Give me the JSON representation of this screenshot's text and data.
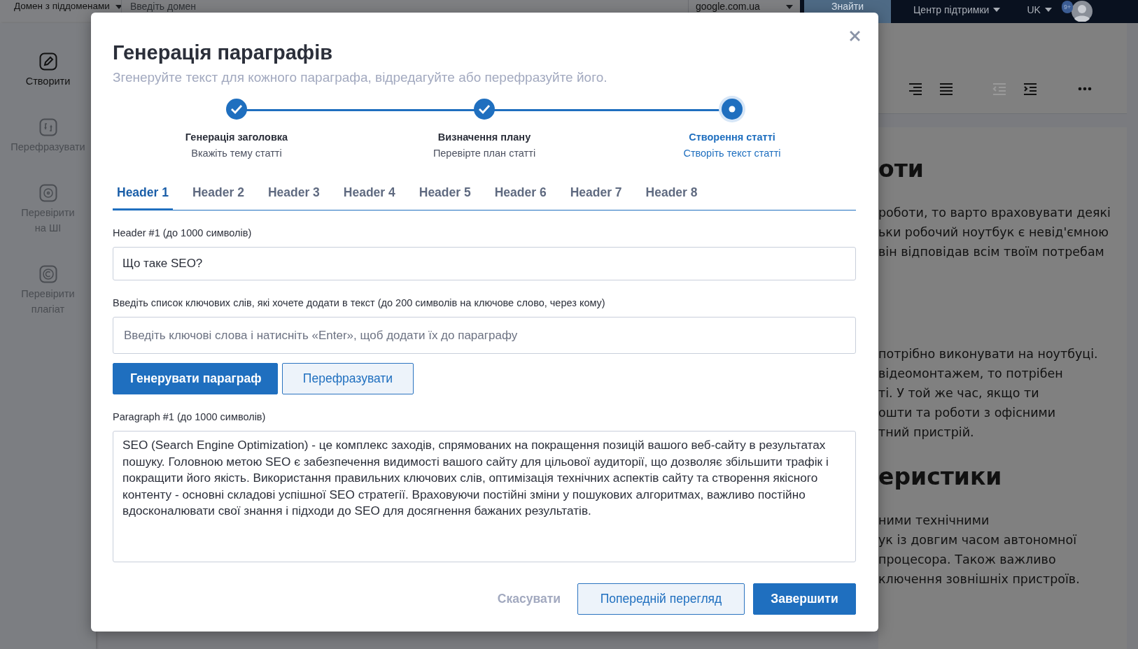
{
  "top_bar": {
    "domain_mode": "Домен з піддоменами",
    "domain_input": {
      "placeholder": "Введіть домен"
    },
    "search_engine": "google.com.ua",
    "search_button": "Знайти",
    "support": "Центр підтримки",
    "language": "UK",
    "notifications_badge": "9+"
  },
  "sidebar": {
    "items": [
      {
        "label": "Створити",
        "kind": "pen",
        "selected": true
      },
      {
        "label": "Перефразувати",
        "kind": "refresh",
        "selected": false
      },
      {
        "label": "Перевірити на ШІ",
        "kind": "target",
        "selected": false
      },
      {
        "label": "Перевірити плагіат",
        "kind": "copyright",
        "selected": false
      }
    ]
  },
  "editor": {
    "toolbar": [
      {
        "kind": "align-right",
        "disabled": false
      },
      {
        "kind": "justify",
        "disabled": false
      },
      {
        "kind": "outdent",
        "disabled": true
      },
      {
        "kind": "indent",
        "disabled": false
      },
      {
        "kind": "more",
        "disabled": false
      }
    ],
    "document": [
      {
        "kind": "heading",
        "lines": [
          "оти"
        ]
      },
      {
        "kind": "paragraph",
        "lines": [
          "роботи, то варто враховувати деякі",
          "ьки робочий ноутбук є невід'ємною",
          "він відповідав всім твоїм потребам"
        ]
      },
      {
        "kind": "paragraph",
        "lines": [
          "потрібно виконувати на ноутбуці.",
          "відеомонтажем, то потрібен",
          "ті. У той же час, якщо ти",
          "ошти та роботи з офісними",
          "тний пристрій."
        ]
      },
      {
        "kind": "heading",
        "lines": [
          "еристики"
        ]
      },
      {
        "kind": "paragraph",
        "lines": [
          "ними технічними",
          "ук із довгим часом автономної",
          "процесора. Також важливо",
          "ключення зовнішніх пристроїв."
        ]
      }
    ]
  },
  "modal": {
    "title": "Генерація параграфів",
    "subtitle": "Згенеруйте текст для кожного параграфа, відредагуйте або перефразуйте його.",
    "steps": [
      {
        "title": "Генерація заголовка",
        "subtitle": "Вкажіть тему статті",
        "completed": true
      },
      {
        "title": "Визначення плану",
        "subtitle": "Перевірте план статті",
        "completed": true
      },
      {
        "title": "Створення статті",
        "subtitle": "Створіть текст статті",
        "completed": false
      }
    ],
    "tabs": [
      {
        "label": "Header 1",
        "selected": true
      },
      {
        "label": "Header 2",
        "selected": false
      },
      {
        "label": "Header 3",
        "selected": false
      },
      {
        "label": "Header 4",
        "selected": false
      },
      {
        "label": "Header 5",
        "selected": false
      },
      {
        "label": "Header 6",
        "selected": false
      },
      {
        "label": "Header 7",
        "selected": false
      },
      {
        "label": "Header 8",
        "selected": false
      }
    ],
    "header_field": {
      "label": "Header #1 (до 1000 символів)",
      "value": "Що таке SEO?"
    },
    "keywords_field": {
      "label": "Введіть список ключових слів, які хочете додати в текст (до 200 символів на ключове слово, через кому)",
      "placeholder": "Введіть ключові слова і натисніть «Enter», щоб додати їх до параграфу"
    },
    "actions": [
      {
        "label": "Генерувати параграф",
        "kind": "primary"
      },
      {
        "label": "Перефразувати",
        "kind": "secondary"
      }
    ],
    "paragraph_field": {
      "label": "Paragraph #1 (до 1000 символів)",
      "value": "SEO (Search Engine Optimization) - це комплекс заходів, спрямованих на покращення позицій вашого веб-сайту в результатах пошуку. Головною метою SEO є забезпечення видимості вашого сайту для цільової аудиторії, що дозволяє збільшити трафік і покращити його якість. Використання правильних ключових слів, оптимізація технічних аспектів сайту та створення якісного контенту - основні складові успішної SEO стратегії. Враховуючи постійні зміни у пошукових алгоритмах, важливо постійно вдосконалювати свої знання і підходи до SEO для досягнення бажаних результатів."
    },
    "footer_buttons": [
      {
        "label": "Скасувати",
        "kind": "link"
      },
      {
        "label": "Попередній перегляд",
        "kind": "secondary"
      },
      {
        "label": "Завершити",
        "kind": "primary"
      }
    ]
  }
}
